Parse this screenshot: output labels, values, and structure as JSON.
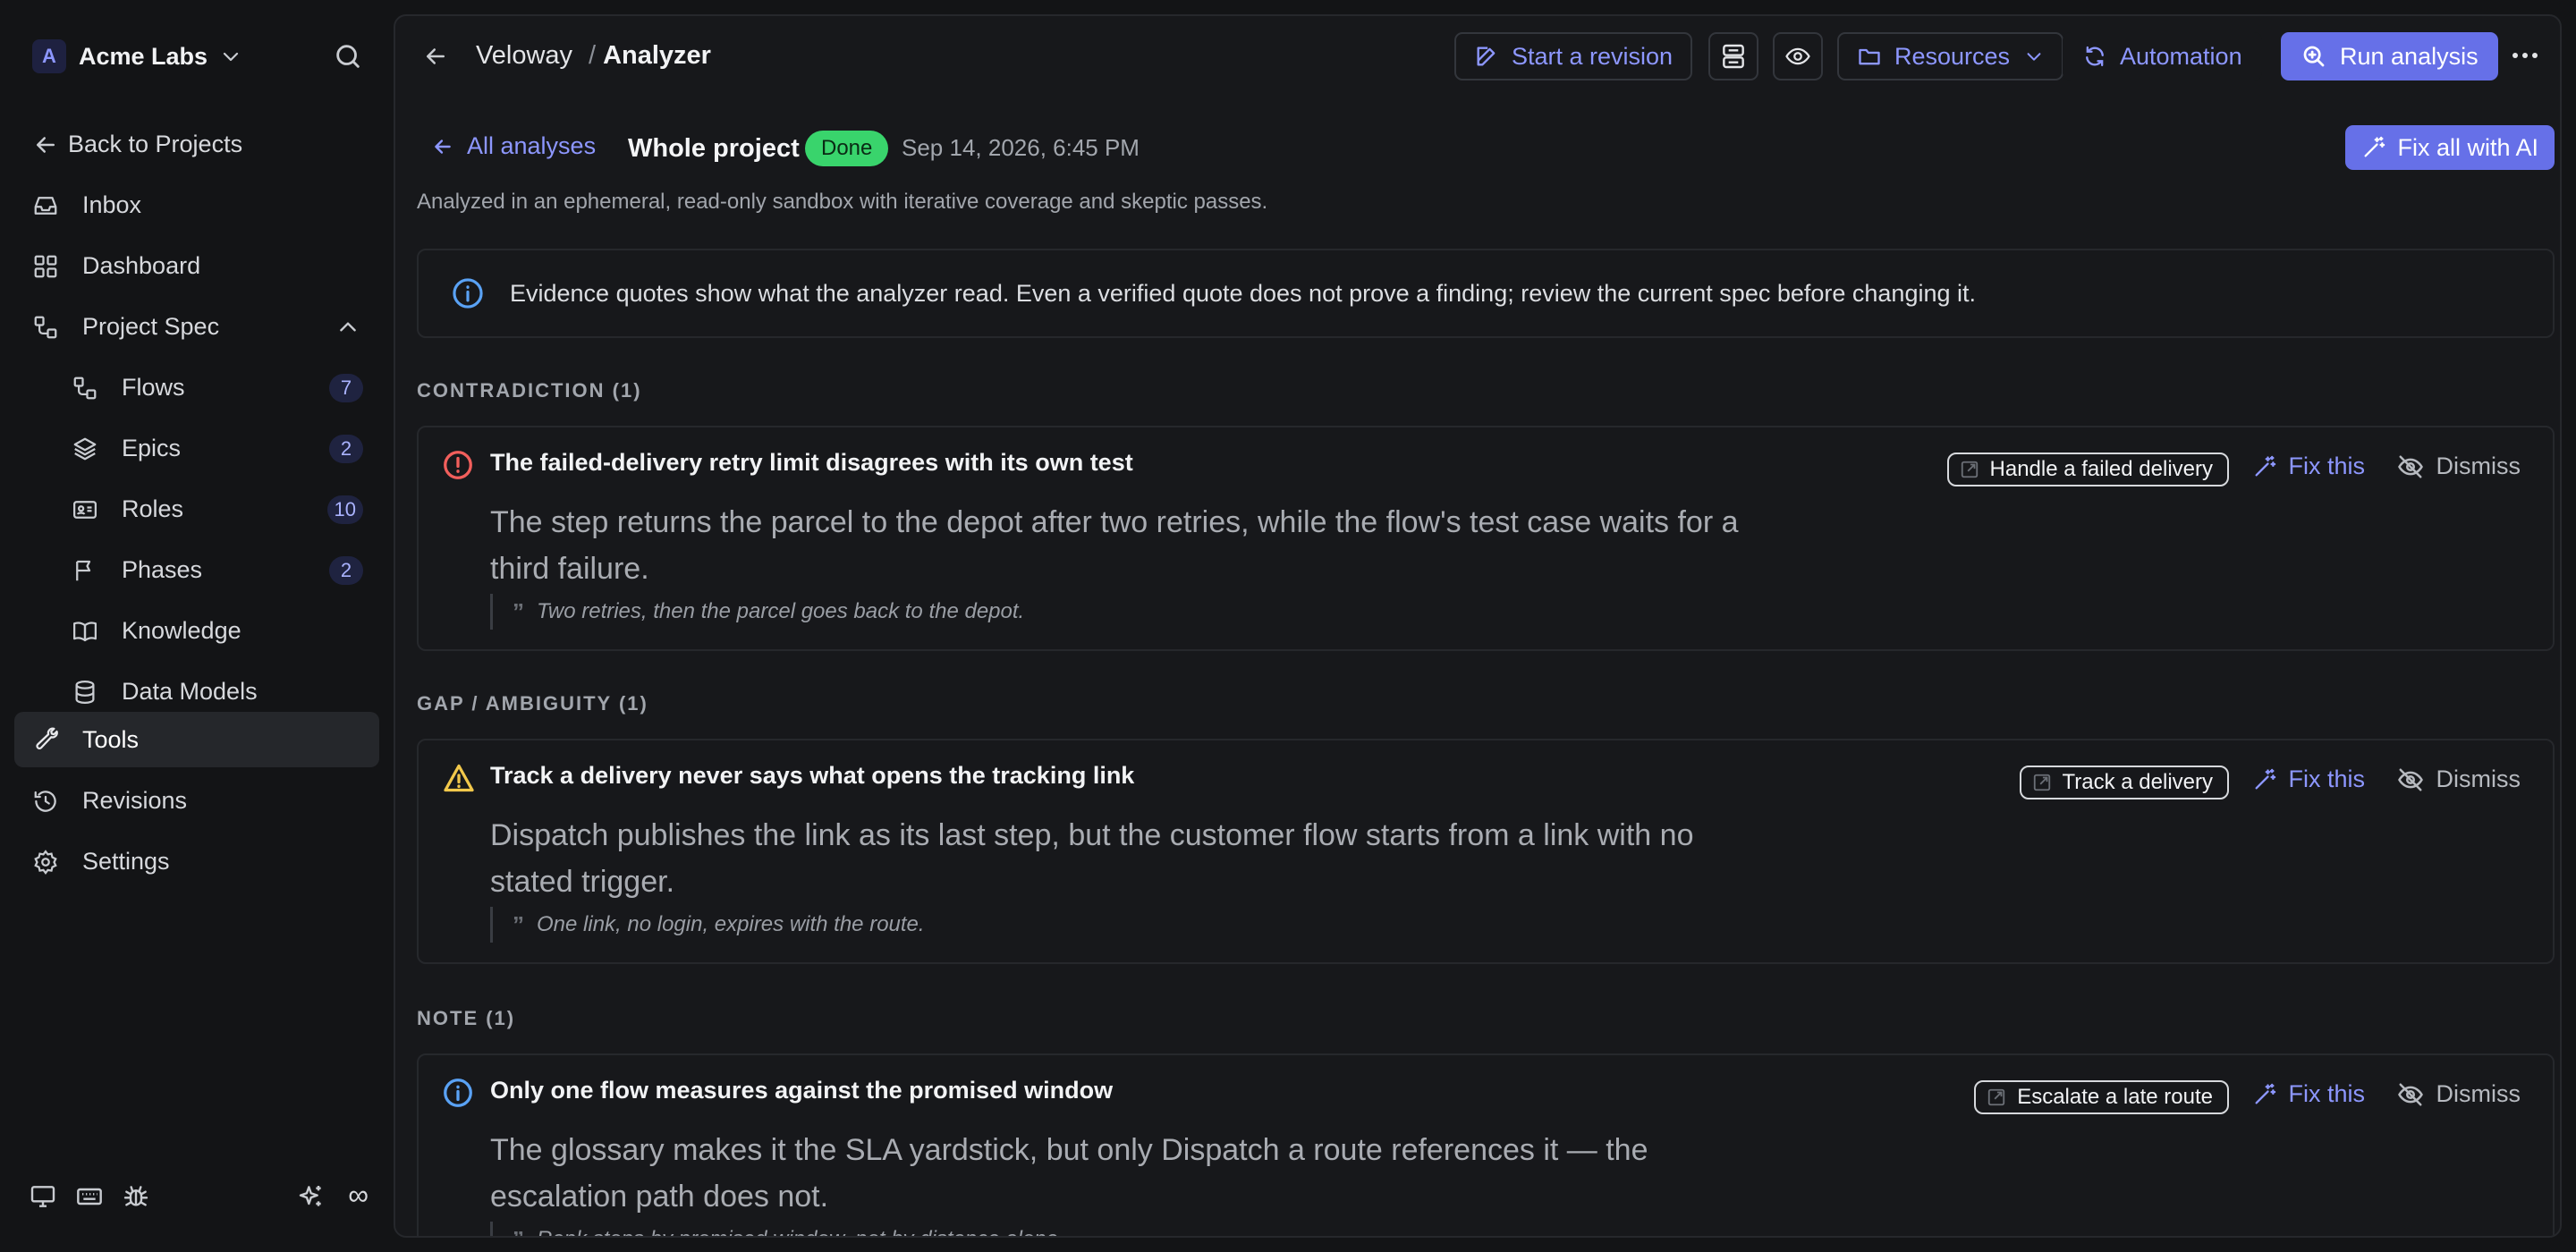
{
  "sidebar": {
    "org_initial": "A",
    "org_name": "Acme Labs",
    "back_label": "Back to Projects",
    "items": [
      {
        "label": "Inbox",
        "icon": "inbox-icon"
      },
      {
        "label": "Dashboard",
        "icon": "dashboard-icon"
      },
      {
        "label": "Project Spec",
        "icon": "project-spec-icon"
      },
      {
        "label": "Flows",
        "icon": "flows-icon",
        "count": "7"
      },
      {
        "label": "Epics",
        "icon": "layers-icon",
        "count": "2"
      },
      {
        "label": "Roles",
        "icon": "id-card-icon",
        "count": "10"
      },
      {
        "label": "Phases",
        "icon": "flag-icon",
        "count": "2"
      },
      {
        "label": "Knowledge",
        "icon": "book-icon"
      },
      {
        "label": "Data Models",
        "icon": "database-icon"
      },
      {
        "label": "Tools",
        "icon": "wrench-icon"
      },
      {
        "label": "Revisions",
        "icon": "history-icon"
      },
      {
        "label": "Settings",
        "icon": "gear-icon"
      }
    ],
    "active_item": "Tools",
    "footer_infinity": "∞"
  },
  "header": {
    "project": "Veloway",
    "separator": "/",
    "page": "Analyzer",
    "start_revision": "Start a revision",
    "resources": "Resources",
    "automation": "Automation",
    "run_analysis": "Run analysis"
  },
  "analysis": {
    "back_label": "All analyses",
    "scope": "Whole project",
    "status": "Done",
    "timestamp": "Sep 14, 2026, 6:45 PM",
    "fix_all": "Fix all with AI",
    "sandbox_note": "Analyzed in an ephemeral, read-only sandbox with iterative coverage and skeptic passes.",
    "info": "Evidence quotes show what the analyzer read. Even a verified quote does not prove a finding; review the current spec before changing it."
  },
  "sections": [
    {
      "heading": "CONTRADICTION (1)",
      "severity_icon": "error-circle-icon",
      "severity_color": "#f25f5c",
      "title": "The failed-delivery retry limit disagrees with its own test",
      "body": "The step returns the parcel to the depot after two retries, while the flow's test case waits for a third failure.",
      "quote": "Two retries, then the parcel goes back to the depot.",
      "flow": "Handle a failed delivery",
      "fix": "Fix this",
      "dismiss": "Dismiss"
    },
    {
      "heading": "GAP / AMBIGUITY (1)",
      "severity_icon": "warning-triangle-icon",
      "severity_color": "#f2c84b",
      "title": "Track a delivery never says what opens the tracking link",
      "body": "Dispatch publishes the link as its last step, but the customer flow starts from a link with no stated trigger.",
      "quote": "One link, no login, expires with the route.",
      "flow": "Track a delivery",
      "fix": "Fix this",
      "dismiss": "Dismiss"
    },
    {
      "heading": "NOTE (1)",
      "severity_icon": "info-circle-icon",
      "severity_color": "#5aa2f5",
      "title": "Only one flow measures against the promised window",
      "body": "The glossary makes it the SLA yardstick, but only Dispatch a route references it — the escalation path does not.",
      "quote": "Rank stops by promised window, not by distance alone.",
      "flow": "Escalate a late route",
      "fix": "Fix this",
      "dismiss": "Dismiss"
    }
  ],
  "colors": {
    "accent": "#6670e8",
    "accent_text": "#8d97ff",
    "done": "#39d46c"
  }
}
